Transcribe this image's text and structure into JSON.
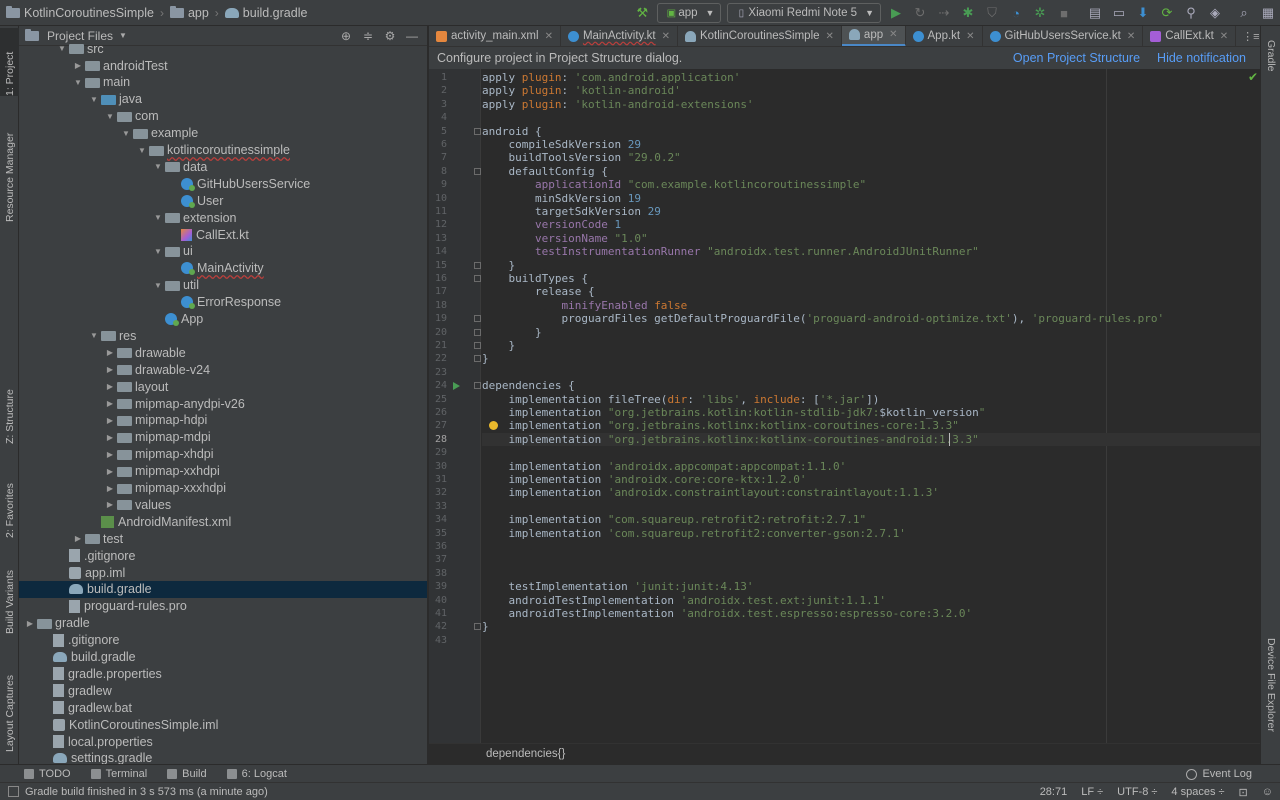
{
  "navbar": {
    "crumbs": [
      "KotlinCoroutinesSimple",
      "app",
      "build.gradle"
    ],
    "run_config": "app",
    "device": "Xiaomi Redmi Note 5"
  },
  "left_strip": {
    "tabs": [
      "1: Project",
      "Resource Manager",
      "Z: Structure",
      "2: Favorites",
      "Build Variants",
      "Layout Captures"
    ]
  },
  "right_strip": {
    "tabs": [
      "Gradle",
      "Device File Explorer"
    ]
  },
  "project_panel": {
    "title": "Project Files",
    "rows": [
      {
        "label": "src",
        "depth": 3,
        "icon": "folder",
        "arrow": "open"
      },
      {
        "label": "androidTest",
        "depth": 4,
        "icon": "folder",
        "arrow": "closed"
      },
      {
        "label": "main",
        "depth": 4,
        "icon": "folder",
        "arrow": "open"
      },
      {
        "label": "java",
        "depth": 5,
        "icon": "folder-src",
        "arrow": "open"
      },
      {
        "label": "com",
        "depth": 6,
        "icon": "folder",
        "arrow": "open"
      },
      {
        "label": "example",
        "depth": 7,
        "icon": "folder",
        "arrow": "open"
      },
      {
        "label": "kotlincoroutinessimple",
        "depth": 8,
        "icon": "folder",
        "arrow": "open",
        "underline": true
      },
      {
        "label": "data",
        "depth": 9,
        "icon": "folder",
        "arrow": "open"
      },
      {
        "label": "GitHubUsersService",
        "depth": 10,
        "icon": "kt",
        "arrow": "none"
      },
      {
        "label": "User",
        "depth": 10,
        "icon": "kt",
        "arrow": "none"
      },
      {
        "label": "extension",
        "depth": 9,
        "icon": "folder",
        "arrow": "open"
      },
      {
        "label": "CallExt.kt",
        "depth": 10,
        "icon": "ktfile",
        "arrow": "none"
      },
      {
        "label": "ui",
        "depth": 9,
        "icon": "folder",
        "arrow": "open"
      },
      {
        "label": "MainActivity",
        "depth": 10,
        "icon": "kt",
        "arrow": "none",
        "underline": true
      },
      {
        "label": "util",
        "depth": 9,
        "icon": "folder",
        "arrow": "open"
      },
      {
        "label": "ErrorResponse",
        "depth": 10,
        "icon": "kt",
        "arrow": "none"
      },
      {
        "label": "App",
        "depth": 9,
        "icon": "kt",
        "arrow": "none"
      },
      {
        "label": "res",
        "depth": 5,
        "icon": "folder-res",
        "arrow": "open"
      },
      {
        "label": "drawable",
        "depth": 6,
        "icon": "folder",
        "arrow": "closed"
      },
      {
        "label": "drawable-v24",
        "depth": 6,
        "icon": "folder",
        "arrow": "closed"
      },
      {
        "label": "layout",
        "depth": 6,
        "icon": "folder",
        "arrow": "closed"
      },
      {
        "label": "mipmap-anydpi-v26",
        "depth": 6,
        "icon": "folder",
        "arrow": "closed"
      },
      {
        "label": "mipmap-hdpi",
        "depth": 6,
        "icon": "folder",
        "arrow": "closed"
      },
      {
        "label": "mipmap-mdpi",
        "depth": 6,
        "icon": "folder",
        "arrow": "closed"
      },
      {
        "label": "mipmap-xhdpi",
        "depth": 6,
        "icon": "folder",
        "arrow": "closed"
      },
      {
        "label": "mipmap-xxhdpi",
        "depth": 6,
        "icon": "folder",
        "arrow": "closed"
      },
      {
        "label": "mipmap-xxxhdpi",
        "depth": 6,
        "icon": "folder",
        "arrow": "closed"
      },
      {
        "label": "values",
        "depth": 6,
        "icon": "folder",
        "arrow": "closed"
      },
      {
        "label": "AndroidManifest.xml",
        "depth": 5,
        "icon": "xml",
        "arrow": "none"
      },
      {
        "label": "test",
        "depth": 4,
        "icon": "folder",
        "arrow": "closed"
      },
      {
        "label": ".gitignore",
        "depth": 3,
        "icon": "file",
        "arrow": "none"
      },
      {
        "label": "app.iml",
        "depth": 3,
        "icon": "iml",
        "arrow": "none"
      },
      {
        "label": "build.gradle",
        "depth": 3,
        "icon": "gradle",
        "arrow": "none",
        "selected": true
      },
      {
        "label": "proguard-rules.pro",
        "depth": 3,
        "icon": "file",
        "arrow": "none"
      },
      {
        "label": "gradle",
        "depth": 1,
        "icon": "folder",
        "arrow": "closed"
      },
      {
        "label": ".gitignore",
        "depth": 2,
        "icon": "file",
        "arrow": "none"
      },
      {
        "label": "build.gradle",
        "depth": 2,
        "icon": "gradle",
        "arrow": "none"
      },
      {
        "label": "gradle.properties",
        "depth": 2,
        "icon": "file",
        "arrow": "none"
      },
      {
        "label": "gradlew",
        "depth": 2,
        "icon": "file",
        "arrow": "none"
      },
      {
        "label": "gradlew.bat",
        "depth": 2,
        "icon": "file",
        "arrow": "none"
      },
      {
        "label": "KotlinCoroutinesSimple.iml",
        "depth": 2,
        "icon": "iml",
        "arrow": "none"
      },
      {
        "label": "local.properties",
        "depth": 2,
        "icon": "file",
        "arrow": "none"
      },
      {
        "label": "settings.gradle",
        "depth": 2,
        "icon": "gradle",
        "arrow": "none"
      }
    ]
  },
  "editor_tabs": [
    {
      "label": "activity_main.xml",
      "icon": "xml",
      "active": false,
      "underline": false
    },
    {
      "label": "MainActivity.kt",
      "icon": "kt",
      "active": false,
      "underline": true
    },
    {
      "label": "KotlinCoroutinesSimple",
      "icon": "gradle",
      "active": false,
      "underline": false
    },
    {
      "label": "app",
      "icon": "gradle",
      "active": true,
      "underline": false
    },
    {
      "label": "App.kt",
      "icon": "kt",
      "active": false,
      "underline": false
    },
    {
      "label": "GitHubUsersService.kt",
      "icon": "kt",
      "active": false,
      "underline": false
    },
    {
      "label": "CallExt.kt",
      "icon": "ktfile",
      "active": false,
      "underline": false
    }
  ],
  "notification": {
    "message": "Configure project in Project Structure dialog.",
    "open_link": "Open Project Structure",
    "hide_link": "Hide notification"
  },
  "editor": {
    "current_line": 28,
    "folds": [
      5,
      8,
      15,
      16,
      19,
      20,
      21,
      22,
      24,
      42
    ],
    "run_line": 24,
    "bulb_line": 27,
    "lines": [
      [
        [
          "ident",
          "apply "
        ],
        [
          "kw",
          "plugin"
        ],
        [
          "ident",
          ": "
        ],
        [
          "str",
          "'com.android.application'"
        ]
      ],
      [
        [
          "ident",
          "apply "
        ],
        [
          "kw",
          "plugin"
        ],
        [
          "ident",
          ": "
        ],
        [
          "str",
          "'kotlin-android'"
        ]
      ],
      [
        [
          "ident",
          "apply "
        ],
        [
          "kw",
          "plugin"
        ],
        [
          "ident",
          ": "
        ],
        [
          "str",
          "'kotlin-android-extensions'"
        ]
      ],
      [],
      [
        [
          "ident",
          "android {"
        ]
      ],
      [
        [
          "ident",
          "    compileSdkVersion "
        ],
        [
          "num",
          "29"
        ]
      ],
      [
        [
          "ident",
          "    buildToolsVersion "
        ],
        [
          "str",
          "\"29.0.2\""
        ]
      ],
      [
        [
          "ident",
          "    defaultConfig {"
        ]
      ],
      [
        [
          "prop",
          "        applicationId "
        ],
        [
          "str",
          "\"com.example.kotlincoroutinessimple\""
        ]
      ],
      [
        [
          "ident",
          "        minSdkVersion "
        ],
        [
          "num",
          "19"
        ]
      ],
      [
        [
          "ident",
          "        targetSdkVersion "
        ],
        [
          "num",
          "29"
        ]
      ],
      [
        [
          "prop",
          "        versionCode "
        ],
        [
          "num",
          "1"
        ]
      ],
      [
        [
          "prop",
          "        versionName "
        ],
        [
          "str",
          "\"1.0\""
        ]
      ],
      [
        [
          "prop",
          "        testInstrumentationRunner "
        ],
        [
          "str",
          "\"androidx.test.runner.AndroidJUnitRunner\""
        ]
      ],
      [
        [
          "ident",
          "    }"
        ]
      ],
      [
        [
          "ident",
          "    buildTypes {"
        ]
      ],
      [
        [
          "ident",
          "        release {"
        ]
      ],
      [
        [
          "prop",
          "            minifyEnabled "
        ],
        [
          "kw",
          "false"
        ]
      ],
      [
        [
          "ident",
          "            proguardFiles getDefaultProguardFile("
        ],
        [
          "str",
          "'proguard-android-optimize.txt'"
        ],
        [
          "ident",
          "), "
        ],
        [
          "str",
          "'proguard-rules.pro'"
        ]
      ],
      [
        [
          "ident",
          "        }"
        ]
      ],
      [
        [
          "ident",
          "    }"
        ]
      ],
      [
        [
          "ident",
          "}"
        ]
      ],
      [],
      [
        [
          "ident",
          "dependencies {"
        ]
      ],
      [
        [
          "ident",
          "    implementation fileTree("
        ],
        [
          "kw",
          "dir"
        ],
        [
          "ident",
          ": "
        ],
        [
          "str",
          "'libs'"
        ],
        [
          "ident",
          ", "
        ],
        [
          "kw",
          "include"
        ],
        [
          "ident",
          ": ["
        ],
        [
          "str",
          "'*.jar'"
        ],
        [
          "ident",
          "])"
        ]
      ],
      [
        [
          "ident",
          "    implementation "
        ],
        [
          "str",
          "\"org.jetbrains.kotlin:kotlin-stdlib-jdk7:"
        ],
        [
          "ident",
          "$kotlin_version"
        ],
        [
          "str",
          "\""
        ]
      ],
      [
        [
          "ident",
          "    implementation "
        ],
        [
          "str",
          "\"org.jetbrains.kotlinx:kotlinx-coroutines-core:1.3.3\""
        ]
      ],
      [
        [
          "ident",
          "    implementation "
        ],
        [
          "str",
          "\"org.jetbrains.kotlinx:kotlinx-coroutines-android:1.3.3\""
        ]
      ],
      [],
      [
        [
          "ident",
          "    implementation "
        ],
        [
          "str",
          "'androidx.appcompat:appcompat:1.1.0'"
        ]
      ],
      [
        [
          "ident",
          "    implementation "
        ],
        [
          "str",
          "'androidx.core:core-ktx:1.2.0'"
        ]
      ],
      [
        [
          "ident",
          "    implementation "
        ],
        [
          "str",
          "'androidx.constraintlayout:constraintlayout:1.1.3'"
        ]
      ],
      [],
      [
        [
          "ident",
          "    implementation "
        ],
        [
          "str",
          "\"com.squareup.retrofit2:retrofit:2.7.1\""
        ]
      ],
      [
        [
          "ident",
          "    implementation "
        ],
        [
          "str",
          "'com.squareup.retrofit2:converter-gson:2.7.1'"
        ]
      ],
      [],
      [],
      [],
      [
        [
          "ident",
          "    testImplementation "
        ],
        [
          "str",
          "'junit:junit:4.13'"
        ]
      ],
      [
        [
          "ident",
          "    androidTestImplementation "
        ],
        [
          "str",
          "'androidx.test.ext:junit:1.1.1'"
        ]
      ],
      [
        [
          "ident",
          "    androidTestImplementation "
        ],
        [
          "str",
          "'androidx.test.espresso:espresso-core:3.2.0'"
        ]
      ],
      [
        [
          "ident",
          "}"
        ]
      ],
      []
    ]
  },
  "editor_breadcrumb": "dependencies{}",
  "bottom_tools": {
    "todo": "TODO",
    "terminal": "Terminal",
    "build": "Build",
    "logcat": "6: Logcat",
    "event_log": "Event Log"
  },
  "statusbar": {
    "message": "Gradle build finished in 3 s 573 ms (a minute ago)",
    "position": "28:71",
    "line_sep": "LF ÷",
    "encoding": "UTF-8 ÷",
    "indent": "4 spaces ÷"
  },
  "colors": {
    "background": "#2b2b2b",
    "panel": "#3c3f41",
    "link": "#589df6",
    "selection": "#0d293e",
    "keyword": "#cc7832",
    "string": "#6a8759",
    "number": "#6897bb",
    "property": "#9876aa"
  }
}
